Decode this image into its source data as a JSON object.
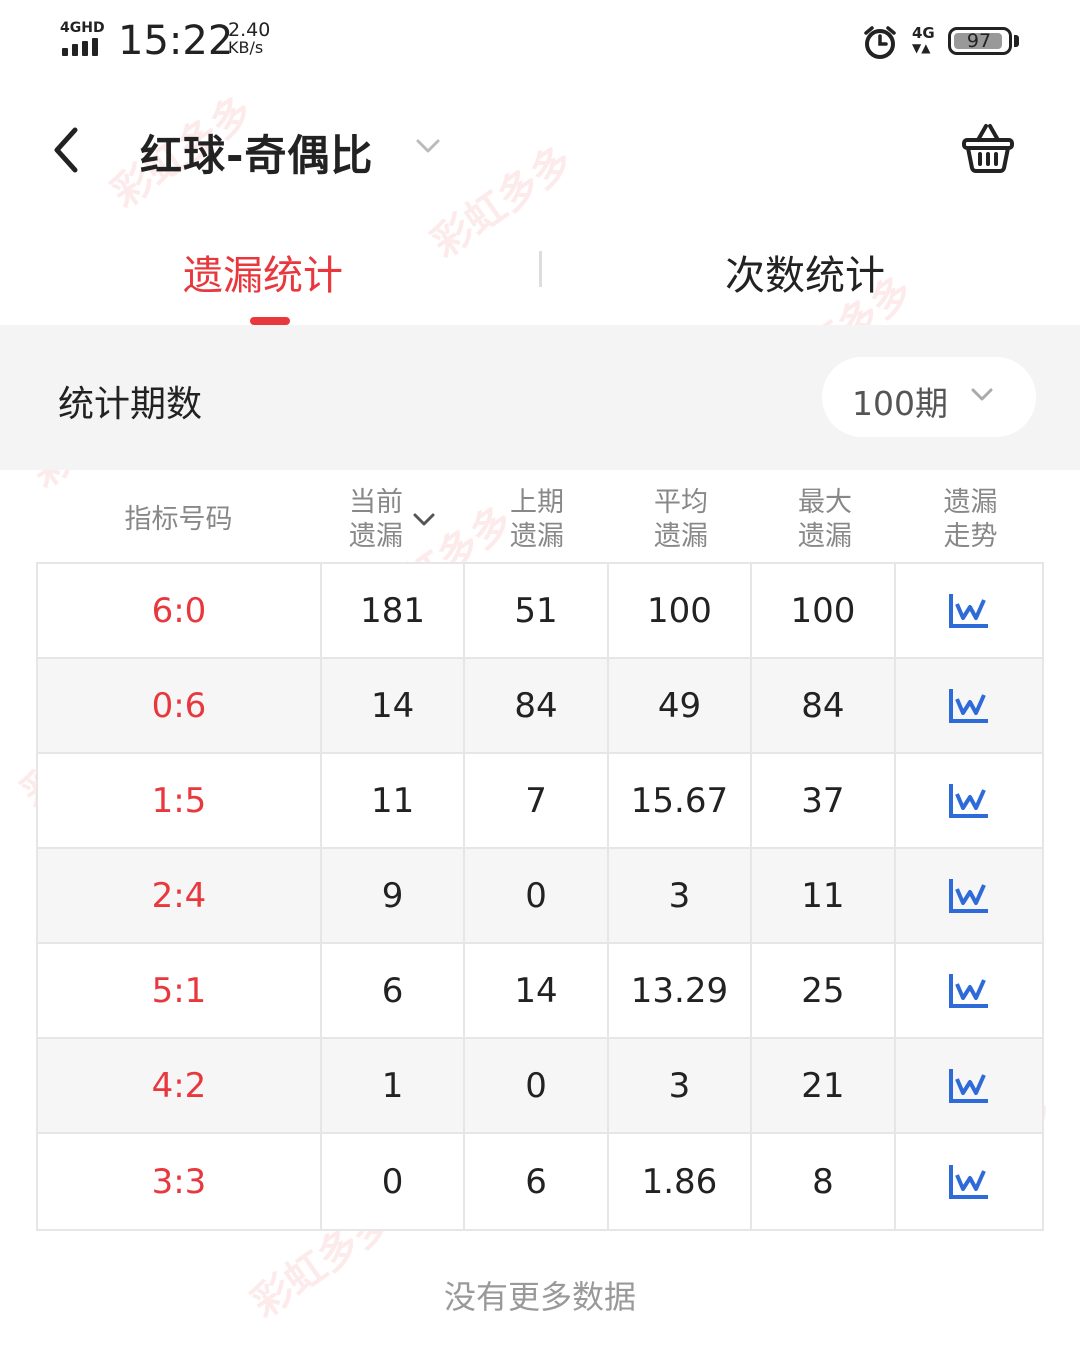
{
  "status_bar": {
    "network_label": "4GHD",
    "time": "15:22",
    "speed_value": "2.40",
    "speed_unit": "KB/s",
    "net_type": "4G",
    "battery": "97"
  },
  "header": {
    "title": "红球-奇偶比"
  },
  "tabs": [
    {
      "label": "遗漏统计",
      "active": true
    },
    {
      "label": "次数统计",
      "active": false
    }
  ],
  "period": {
    "label": "统计期数",
    "value": "100期"
  },
  "table": {
    "headers": [
      [
        "指标号码",
        ""
      ],
      [
        "当前",
        "遗漏"
      ],
      [
        "上期",
        "遗漏"
      ],
      [
        "平均",
        "遗漏"
      ],
      [
        "最大",
        "遗漏"
      ],
      [
        "遗漏",
        "走势"
      ]
    ],
    "rows": [
      [
        "6:0",
        "181",
        "51",
        "100",
        "100"
      ],
      [
        "0:6",
        "14",
        "84",
        "49",
        "84"
      ],
      [
        "1:5",
        "11",
        "7",
        "15.67",
        "37"
      ],
      [
        "2:4",
        "9",
        "0",
        "3",
        "11"
      ],
      [
        "5:1",
        "6",
        "14",
        "13.29",
        "25"
      ],
      [
        "4:2",
        "1",
        "0",
        "3",
        "21"
      ],
      [
        "3:3",
        "0",
        "6",
        "1.86",
        "8"
      ]
    ]
  },
  "footer": {
    "text": "没有更多数据"
  },
  "watermark": "彩虹多多",
  "colors": {
    "accent": "#e8383d",
    "trend_icon": "#2f6bd8",
    "band_bg": "#f4f4f4"
  }
}
